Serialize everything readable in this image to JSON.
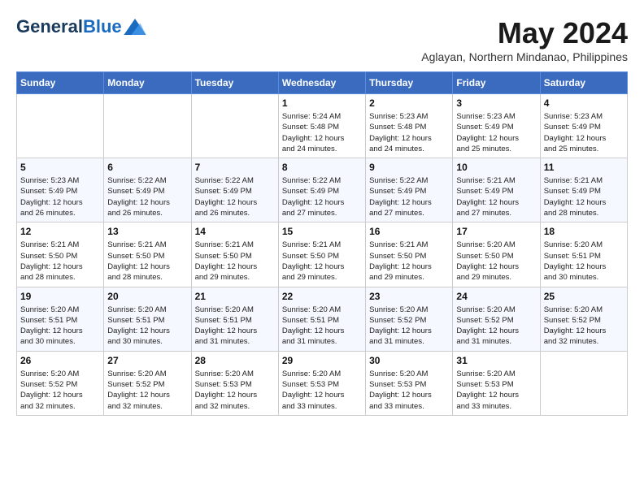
{
  "header": {
    "logo_general": "General",
    "logo_blue": "Blue",
    "month_year": "May 2024",
    "location": "Aglayan, Northern Mindanao, Philippines"
  },
  "weekdays": [
    "Sunday",
    "Monday",
    "Tuesday",
    "Wednesday",
    "Thursday",
    "Friday",
    "Saturday"
  ],
  "weeks": [
    [
      {
        "day": "",
        "info": ""
      },
      {
        "day": "",
        "info": ""
      },
      {
        "day": "",
        "info": ""
      },
      {
        "day": "1",
        "info": "Sunrise: 5:24 AM\nSunset: 5:48 PM\nDaylight: 12 hours\nand 24 minutes."
      },
      {
        "day": "2",
        "info": "Sunrise: 5:23 AM\nSunset: 5:48 PM\nDaylight: 12 hours\nand 24 minutes."
      },
      {
        "day": "3",
        "info": "Sunrise: 5:23 AM\nSunset: 5:49 PM\nDaylight: 12 hours\nand 25 minutes."
      },
      {
        "day": "4",
        "info": "Sunrise: 5:23 AM\nSunset: 5:49 PM\nDaylight: 12 hours\nand 25 minutes."
      }
    ],
    [
      {
        "day": "5",
        "info": "Sunrise: 5:23 AM\nSunset: 5:49 PM\nDaylight: 12 hours\nand 26 minutes."
      },
      {
        "day": "6",
        "info": "Sunrise: 5:22 AM\nSunset: 5:49 PM\nDaylight: 12 hours\nand 26 minutes."
      },
      {
        "day": "7",
        "info": "Sunrise: 5:22 AM\nSunset: 5:49 PM\nDaylight: 12 hours\nand 26 minutes."
      },
      {
        "day": "8",
        "info": "Sunrise: 5:22 AM\nSunset: 5:49 PM\nDaylight: 12 hours\nand 27 minutes."
      },
      {
        "day": "9",
        "info": "Sunrise: 5:22 AM\nSunset: 5:49 PM\nDaylight: 12 hours\nand 27 minutes."
      },
      {
        "day": "10",
        "info": "Sunrise: 5:21 AM\nSunset: 5:49 PM\nDaylight: 12 hours\nand 27 minutes."
      },
      {
        "day": "11",
        "info": "Sunrise: 5:21 AM\nSunset: 5:49 PM\nDaylight: 12 hours\nand 28 minutes."
      }
    ],
    [
      {
        "day": "12",
        "info": "Sunrise: 5:21 AM\nSunset: 5:50 PM\nDaylight: 12 hours\nand 28 minutes."
      },
      {
        "day": "13",
        "info": "Sunrise: 5:21 AM\nSunset: 5:50 PM\nDaylight: 12 hours\nand 28 minutes."
      },
      {
        "day": "14",
        "info": "Sunrise: 5:21 AM\nSunset: 5:50 PM\nDaylight: 12 hours\nand 29 minutes."
      },
      {
        "day": "15",
        "info": "Sunrise: 5:21 AM\nSunset: 5:50 PM\nDaylight: 12 hours\nand 29 minutes."
      },
      {
        "day": "16",
        "info": "Sunrise: 5:21 AM\nSunset: 5:50 PM\nDaylight: 12 hours\nand 29 minutes."
      },
      {
        "day": "17",
        "info": "Sunrise: 5:20 AM\nSunset: 5:50 PM\nDaylight: 12 hours\nand 29 minutes."
      },
      {
        "day": "18",
        "info": "Sunrise: 5:20 AM\nSunset: 5:51 PM\nDaylight: 12 hours\nand 30 minutes."
      }
    ],
    [
      {
        "day": "19",
        "info": "Sunrise: 5:20 AM\nSunset: 5:51 PM\nDaylight: 12 hours\nand 30 minutes."
      },
      {
        "day": "20",
        "info": "Sunrise: 5:20 AM\nSunset: 5:51 PM\nDaylight: 12 hours\nand 30 minutes."
      },
      {
        "day": "21",
        "info": "Sunrise: 5:20 AM\nSunset: 5:51 PM\nDaylight: 12 hours\nand 31 minutes."
      },
      {
        "day": "22",
        "info": "Sunrise: 5:20 AM\nSunset: 5:51 PM\nDaylight: 12 hours\nand 31 minutes."
      },
      {
        "day": "23",
        "info": "Sunrise: 5:20 AM\nSunset: 5:52 PM\nDaylight: 12 hours\nand 31 minutes."
      },
      {
        "day": "24",
        "info": "Sunrise: 5:20 AM\nSunset: 5:52 PM\nDaylight: 12 hours\nand 31 minutes."
      },
      {
        "day": "25",
        "info": "Sunrise: 5:20 AM\nSunset: 5:52 PM\nDaylight: 12 hours\nand 32 minutes."
      }
    ],
    [
      {
        "day": "26",
        "info": "Sunrise: 5:20 AM\nSunset: 5:52 PM\nDaylight: 12 hours\nand 32 minutes."
      },
      {
        "day": "27",
        "info": "Sunrise: 5:20 AM\nSunset: 5:52 PM\nDaylight: 12 hours\nand 32 minutes."
      },
      {
        "day": "28",
        "info": "Sunrise: 5:20 AM\nSunset: 5:53 PM\nDaylight: 12 hours\nand 32 minutes."
      },
      {
        "day": "29",
        "info": "Sunrise: 5:20 AM\nSunset: 5:53 PM\nDaylight: 12 hours\nand 33 minutes."
      },
      {
        "day": "30",
        "info": "Sunrise: 5:20 AM\nSunset: 5:53 PM\nDaylight: 12 hours\nand 33 minutes."
      },
      {
        "day": "31",
        "info": "Sunrise: 5:20 AM\nSunset: 5:53 PM\nDaylight: 12 hours\nand 33 minutes."
      },
      {
        "day": "",
        "info": ""
      }
    ]
  ]
}
